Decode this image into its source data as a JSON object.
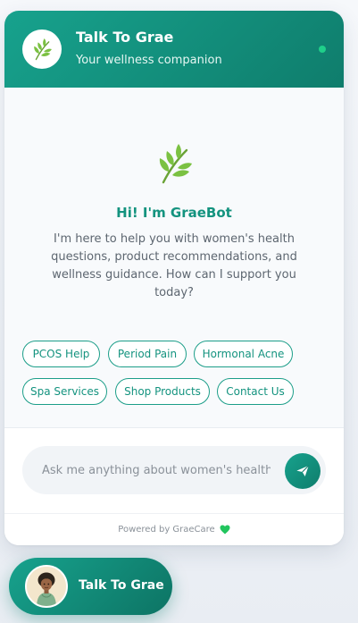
{
  "header": {
    "title": "Talk To Grae",
    "subtitle": "Your wellness companion"
  },
  "welcome": {
    "title": "Hi! I'm GraeBot",
    "message": "I'm here to help you with women's health questions, product recommendations, and wellness guidance. How can I support you today?"
  },
  "quick_replies": [
    {
      "label": "PCOS Help"
    },
    {
      "label": "Period Pain"
    },
    {
      "label": "Hormonal Acne"
    },
    {
      "label": "Spa Services"
    },
    {
      "label": "Shop Products"
    },
    {
      "label": "Contact Us"
    }
  ],
  "input": {
    "placeholder": "Ask me anything about women's health...",
    "value": ""
  },
  "footer": {
    "text": "Powered by GraeCare"
  },
  "launcher": {
    "label": "Talk To Grae"
  },
  "icons": {
    "header_avatar": "leaf-icon",
    "welcome": "leaf-icon",
    "send": "send-icon",
    "footer": "heart-icon",
    "launcher_avatar": "avatar"
  },
  "colors": {
    "brand_teal": "#17a28d",
    "brand_teal_dark": "#0f7d6c",
    "leaf_green": "#7bc142",
    "status_online": "#1fcf8a",
    "heart_green": "#22c55e"
  }
}
